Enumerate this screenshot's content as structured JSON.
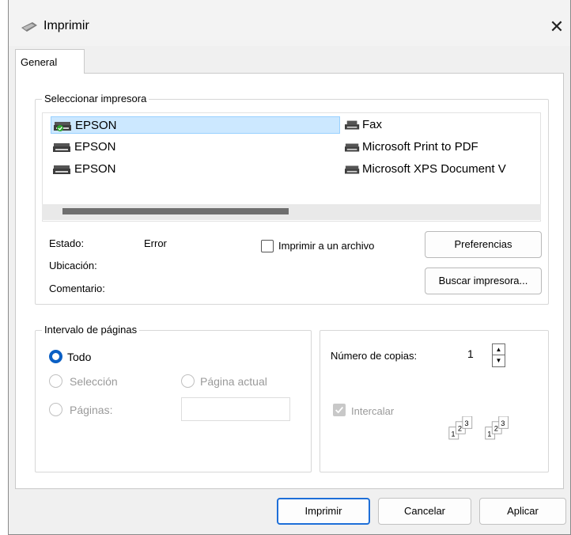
{
  "dialog": {
    "title": "Imprimir",
    "close_symbol": "✕",
    "tab": "General"
  },
  "select_printer": {
    "group_label": "Seleccionar impresora",
    "printers_left": [
      "EPSON",
      "EPSON",
      "EPSON"
    ],
    "printers_right": [
      "Fax",
      "Microsoft Print to PDF",
      "Microsoft XPS Document V"
    ],
    "selected": "EPSON"
  },
  "status": {
    "estado_label": "Estado:",
    "estado_value": "Error",
    "ubicacion_label": "Ubicación:",
    "comentario_label": "Comentario:",
    "print_to_file_label": "Imprimir a un archivo",
    "preferences_button": "Preferencias",
    "find_printer_button": "Buscar impresora..."
  },
  "page_range": {
    "group_label": "Intervalo de páginas",
    "all_label": "Todo",
    "selection_label": "Selección",
    "current_page_label": "Página actual",
    "pages_label": "Páginas:",
    "pages_value": ""
  },
  "copies": {
    "number_label": "Número de copias:",
    "number_value": "1",
    "collate_label": "Intercalar"
  },
  "footer": {
    "print_button": "Imprimir",
    "cancel_button": "Cancelar",
    "apply_button": "Aplicar"
  },
  "icons": {
    "title_icon": "printer-icon",
    "printer_icon": "printer-icon",
    "fax_icon": "fax-icon",
    "collate_icon": "collate-pages-icon"
  },
  "colors": {
    "accent": "#0a5fc4",
    "selection": "#cce8ff",
    "default_printer_check": "#2aa52a"
  }
}
